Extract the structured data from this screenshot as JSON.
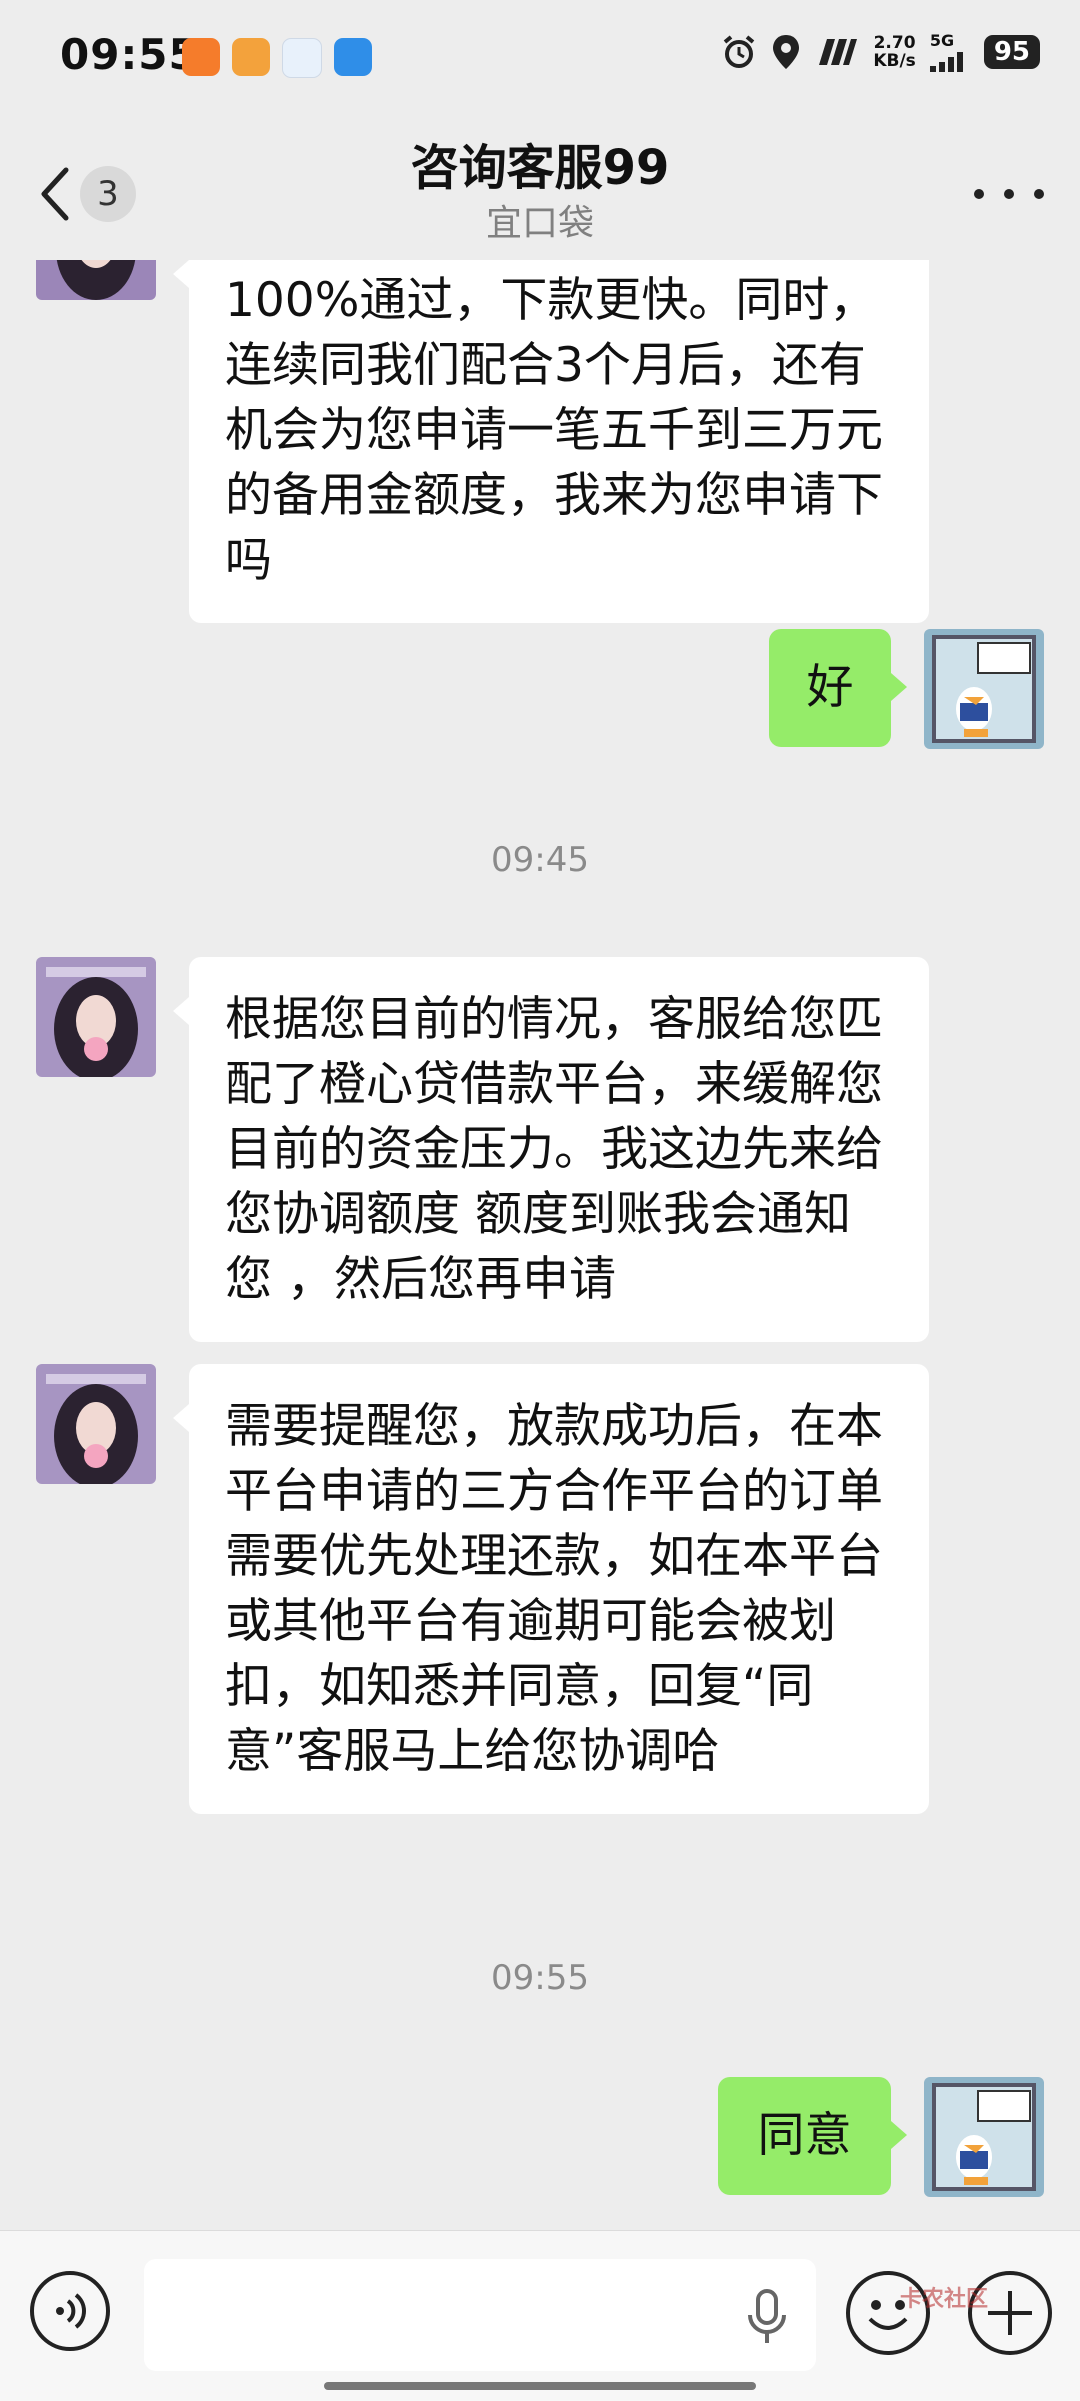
{
  "status_bar": {
    "time": "09:55",
    "speed_value": "2.70",
    "speed_unit": "KB/s",
    "network": "5G",
    "battery": "95"
  },
  "nav": {
    "back_badge": "3",
    "title": "咨询客服99",
    "subtitle": "宜口袋"
  },
  "messages": {
    "m1": "100%通过，下款更快。同时，连续同我们配合3个月后，还有机会为您申请一笔五千到三万元的备用金额度，我来为您申请下吗",
    "m2": "好",
    "t1": "09:45",
    "m3": "根据您目前的情况，客服给您匹配了橙心贷借款平台，来缓解您目前的资金压力。我这边先来给您协调额度 额度到账我会通知您 ，然后您再申请",
    "m4": "需要提醒您，放款成功后，在本平台申请的三方合作平台的订单需要优先处理还款，如在本平台或其他平台有逾期可能会被划扣，如知悉并同意，回复“同意”客服马上给您协调哈",
    "t2": "09:55",
    "m5": "同意"
  },
  "input": {
    "placeholder": ""
  },
  "watermark": "卡农社区",
  "colors": {
    "background": "#ededed",
    "incoming_bubble": "#ffffff",
    "outgoing_bubble": "#95ec69"
  }
}
